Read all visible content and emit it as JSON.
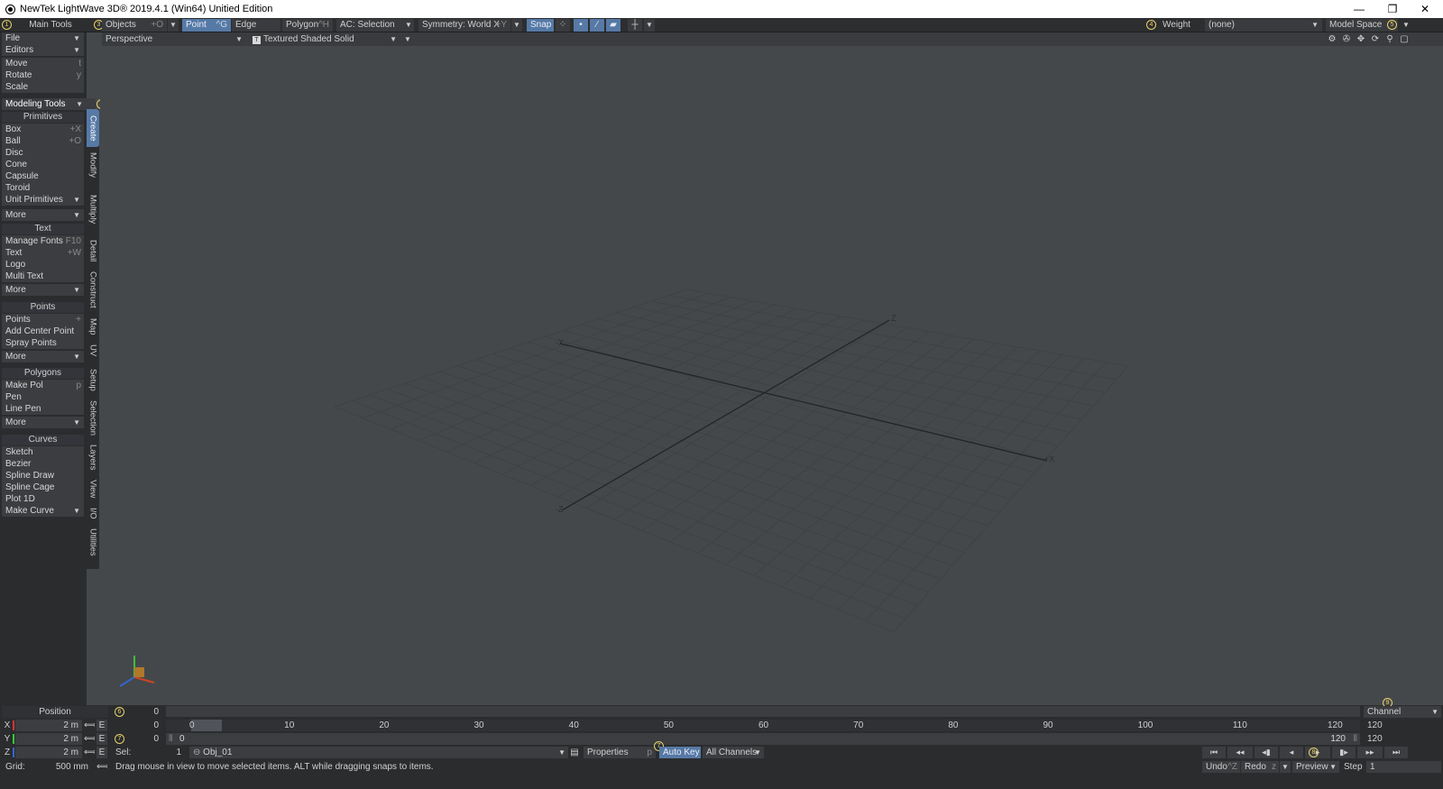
{
  "window": {
    "title": "NewTek LightWave 3D® 2019.4.1 (Win64) Unitied Edition",
    "minimize": "—",
    "restore": "❐",
    "close": "✕"
  },
  "toolbar": {
    "main_tools_marker": "1",
    "main_tools": "Main Tools",
    "objects_marker": "3",
    "objects": "Objects",
    "objects_shortcut": "+O",
    "point": "Point",
    "point_shortcut": "^G",
    "edge": "Edge",
    "polygon": "Polygon",
    "polygon_shortcut": "^H",
    "ac_selection": "AC: Selection",
    "symmetry": "Symmetry: World X",
    "symmetry_shortcut": "+Y",
    "snap": "Snap",
    "weight_marker": "4",
    "weight": "Weight",
    "weight_value": "(none)",
    "model_space": "Model Space",
    "model_space_marker": "5"
  },
  "viewport_bar": {
    "view": "Perspective",
    "shading": "Textured Shaded Solid"
  },
  "left_menu": {
    "file": "File",
    "editors": "Editors",
    "move": "Move",
    "move_sc": "t",
    "rotate": "Rotate",
    "rotate_sc": "y",
    "scale": "Scale",
    "modeling_tools": "Modeling Tools",
    "modeling_marker": "2",
    "sections": {
      "primitives": {
        "title": "Primitives",
        "items": [
          {
            "label": "Box",
            "sc": "+X"
          },
          {
            "label": "Ball",
            "sc": "+O"
          },
          {
            "label": "Disc",
            "sc": ""
          },
          {
            "label": "Cone",
            "sc": ""
          },
          {
            "label": "Capsule",
            "sc": ""
          },
          {
            "label": "Toroid",
            "sc": ""
          }
        ],
        "dropdown": "Unit Primitives",
        "more": "More"
      },
      "text": {
        "title": "Text",
        "items": [
          {
            "label": "Manage Fonts",
            "sc": "F10"
          },
          {
            "label": "Text",
            "sc": "+W"
          },
          {
            "label": "Logo",
            "sc": ""
          },
          {
            "label": "Multi Text",
            "sc": ""
          }
        ],
        "more": "More"
      },
      "points": {
        "title": "Points",
        "items": [
          {
            "label": "Points",
            "sc": "+"
          },
          {
            "label": "Add Center Point",
            "sc": ""
          },
          {
            "label": "Spray Points",
            "sc": ""
          }
        ],
        "more": "More"
      },
      "polygons": {
        "title": "Polygons",
        "items": [
          {
            "label": "Make Pol",
            "sc": "p"
          },
          {
            "label": "Pen",
            "sc": ""
          },
          {
            "label": "Line Pen",
            "sc": ""
          }
        ],
        "more": "More"
      },
      "curves": {
        "title": "Curves",
        "items": [
          {
            "label": "Sketch",
            "sc": ""
          },
          {
            "label": "Bezier",
            "sc": ""
          },
          {
            "label": "Spline Draw",
            "sc": ""
          },
          {
            "label": "Spline Cage",
            "sc": ""
          },
          {
            "label": "Plot 1D",
            "sc": ""
          }
        ],
        "dropdown": "Make Curve"
      }
    }
  },
  "vertical_tabs": [
    "Create",
    "Modify",
    "Multiply",
    "Detail",
    "Construct",
    "Map",
    "UV",
    "Setup",
    "Selection",
    "Layers",
    "View",
    "I/O",
    "Utilities"
  ],
  "viewport": {
    "axis_labels": {
      "neg_x": "-X",
      "pos_x": "+X",
      "pos_z": "Z",
      "neg_z": "-Z"
    }
  },
  "bottom": {
    "position_label": "Position",
    "marker6": "6",
    "marker7": "7",
    "marker7b": "7",
    "marker8": "8",
    "marker9": "9",
    "x_label": "X",
    "y_label": "Y",
    "z_label": "Z",
    "x_value": "2 m",
    "y_value": "2 m",
    "z_value": "2 m",
    "env_label": "E",
    "frame_top": "0",
    "frame_x": "0",
    "frame_y": "0",
    "timeline_ticks": [
      "0",
      "10",
      "20",
      "30",
      "40",
      "50",
      "60",
      "70",
      "80",
      "90",
      "100",
      "110",
      "120"
    ],
    "range_start": "0",
    "range_end": "120",
    "channel": "Channel",
    "end_frame_1": "120",
    "end_frame_2": "120",
    "sel_label": "Sel:",
    "sel_count": "1",
    "object_name": "Obj_01",
    "properties": "Properties",
    "properties_sc": "p",
    "auto_key": "Auto Key",
    "all_channels": "All Channels",
    "grid_label": "Grid:",
    "grid_value": "500 mm",
    "status": "Drag mouse in view to move selected items. ALT while dragging snaps to items.",
    "undo": "Undo",
    "undo_sc": "^Z",
    "redo": "Redo",
    "redo_sc": "z",
    "preview": "Preview",
    "step_label": "Step",
    "step_value": "1"
  }
}
